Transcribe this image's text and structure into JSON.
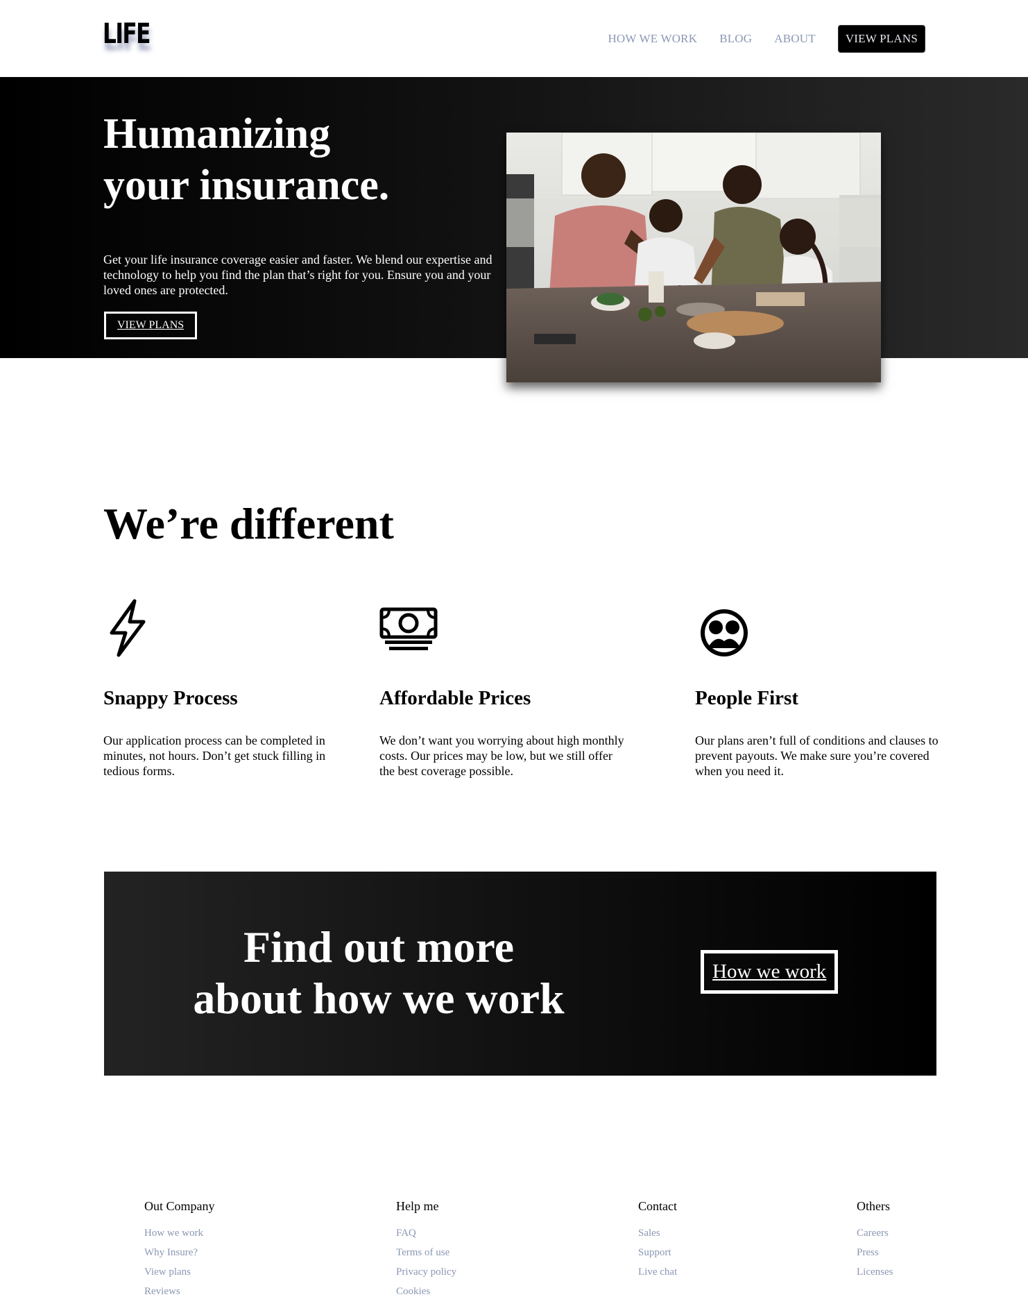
{
  "header": {
    "logo": "LIFE",
    "nav": [
      "HOW WE WORK",
      "BLOG",
      "ABOUT"
    ],
    "cta": "VIEW PLANS"
  },
  "hero": {
    "title_line1": "Humanizing",
    "title_line2": "your insurance.",
    "text": "Get your life insurance coverage easier and faster. We blend our expertise and technology to help you find the plan that’s right for you. Ensure you and your loved ones are protected.",
    "button": "VIEW PLANS"
  },
  "different": {
    "title": "We’re different",
    "features": [
      {
        "icon": "lightning-icon",
        "title": "Snappy Process",
        "text": "Our application process can be completed in minutes, not hours. Don’t get stuck filling in tedious forms."
      },
      {
        "icon": "money-icon",
        "title": "Affordable Prices",
        "text": "We don’t want you worrying about high monthly costs. Our prices may be low, but we still offer the best coverage possible."
      },
      {
        "icon": "people-icon",
        "title": "People First",
        "text": "Our plans aren’t full of conditions and clauses to prevent payouts. We make sure you’re covered when you need it."
      }
    ]
  },
  "cta_banner": {
    "title_line1": "Find out more",
    "title_line2": "about how we work",
    "button": "How we work"
  },
  "footer": {
    "columns": [
      {
        "heading": "Out Company",
        "links": [
          "How we work",
          "Why Insure?",
          "View plans",
          "Reviews"
        ]
      },
      {
        "heading": "Help me",
        "links": [
          "FAQ",
          "Terms of use",
          "Privacy policy",
          "Cookies"
        ]
      },
      {
        "heading": "Contact",
        "links": [
          "Sales",
          "Support",
          "Live chat"
        ]
      },
      {
        "heading": "Others",
        "links": [
          "Careers",
          "Press",
          "Licenses"
        ]
      }
    ]
  }
}
